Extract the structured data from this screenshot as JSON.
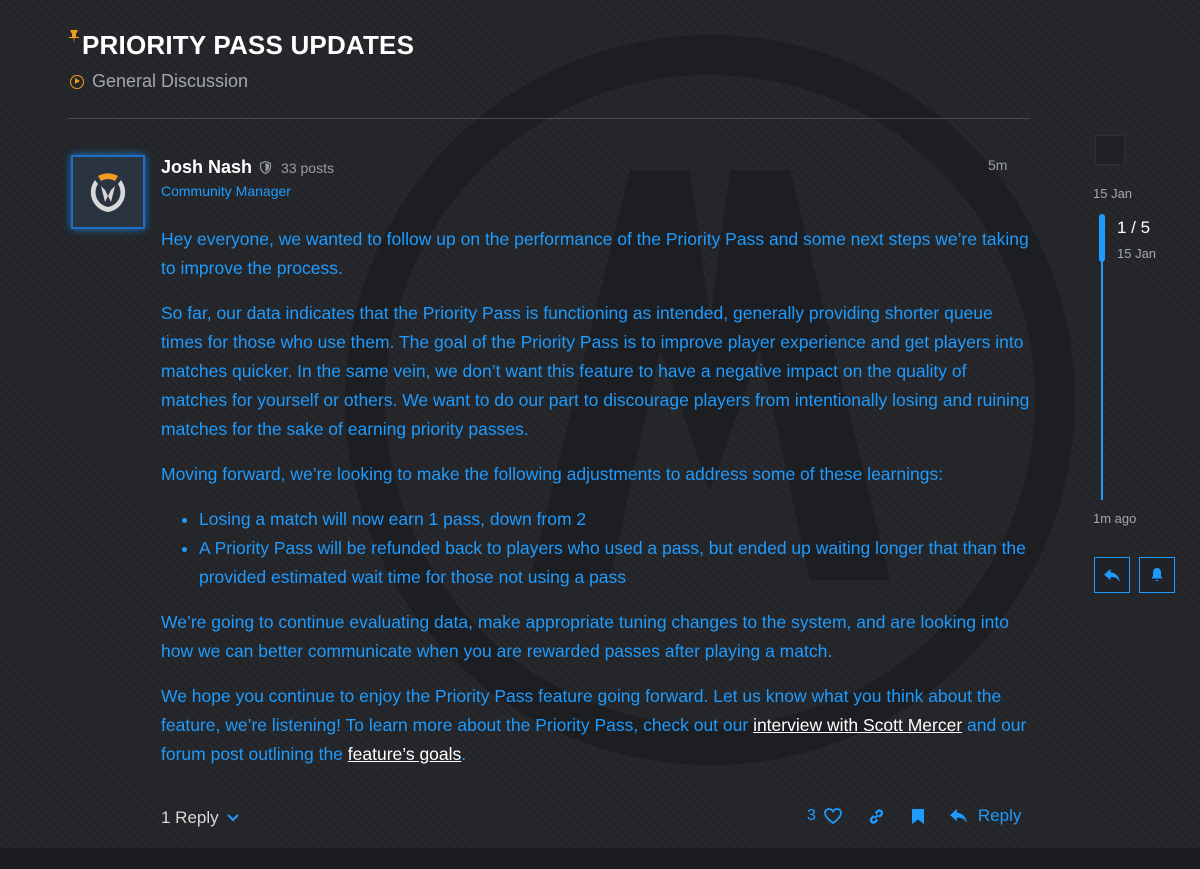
{
  "topic": {
    "title": "PRIORITY PASS UPDATES",
    "category": "General Discussion",
    "pinned": true
  },
  "post": {
    "author": "Josh Nash",
    "author_title": "Community Manager",
    "post_count": "33 posts",
    "time": "5m",
    "paragraphs": {
      "p1": "Hey everyone, we wanted to follow up on the performance of the Priority Pass and some next steps we’re taking to improve the process.",
      "p2": "So far, our data indicates that the Priority Pass is functioning as intended, generally providing shorter queue times for those who use them. The goal of the Priority Pass is to improve player experience and get players into matches quicker. In the same vein, we don’t want this feature to have a negative impact on the quality of matches for yourself or others. We want to do our part to discourage players from intentionally losing and ruining matches for the sake of earning priority passes.",
      "p3": "Moving forward, we’re looking to make the following adjustments to address some of these learnings:",
      "bullets": [
        "Losing a match will now earn 1 pass, down from 2",
        "A Priority Pass will be refunded back to players who used a pass, but ended up waiting longer that than the provided estimated wait time for those not using a pass"
      ],
      "p4": "We’re going to continue evaluating data, make appropriate tuning changes to the system, and are looking into how we can better communicate when you are rewarded passes after playing a match.",
      "p5_a": "We hope you continue to enjoy the Priority Pass feature going forward. Let us know what you think about the feature, we’re listening! To learn more about the Priority Pass, check out our ",
      "link1": "interview with Scott Mercer",
      "p5_b": " and our forum post outlining the ",
      "link2": "feature’s goals",
      "p5_c": "."
    },
    "replies_label": "1 Reply",
    "like_count": "3",
    "reply_label": "Reply"
  },
  "timeline": {
    "start_date": "15 Jan",
    "current": "1 / 5",
    "current_date": "15 Jan",
    "end": "1m ago"
  },
  "colors": {
    "accent": "#1e9bff",
    "pin": "#f29c1f",
    "background": "#232528"
  },
  "icons": {
    "pin": "pin-icon",
    "category": "play-circle-icon",
    "moderator": "shield-icon",
    "like": "heart-icon",
    "share": "link-icon",
    "bookmark": "bookmark-icon",
    "reply": "reply-icon",
    "notifications": "bell-icon"
  }
}
